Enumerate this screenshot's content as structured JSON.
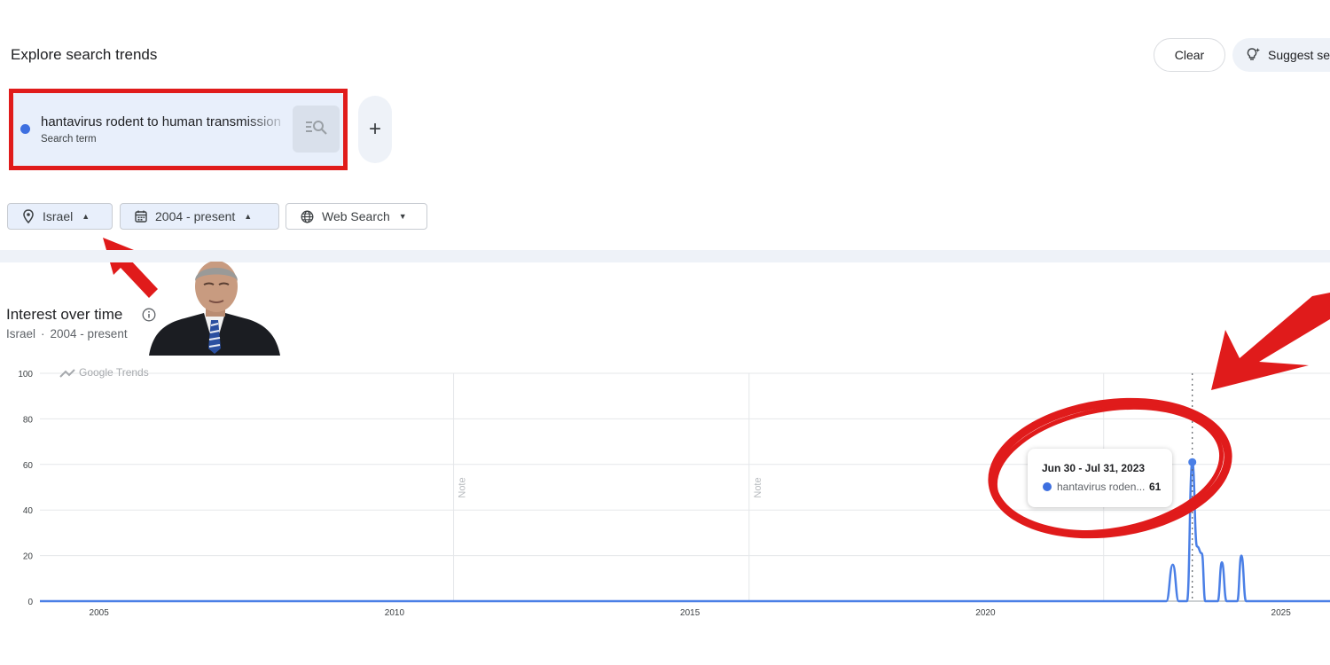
{
  "header": {
    "title": "Explore search trends",
    "clear_label": "Clear",
    "suggest_label": "Suggest sea"
  },
  "search_term": {
    "text": "hantavirus rodent to human transmission",
    "type_label": "Search term",
    "color": "#3d6fe0"
  },
  "add_term_label": "+",
  "filters": {
    "geo": "Israel",
    "time": "2004 - present",
    "property": "Web Search"
  },
  "section": {
    "title": "Interest over time",
    "sub_geo": "Israel",
    "sub_sep": "·",
    "sub_time": "2004 - present"
  },
  "chart_data": {
    "type": "line",
    "watermark": "Google Trends",
    "ylim": [
      0,
      100
    ],
    "yticks": [
      0,
      20,
      40,
      60,
      80,
      100
    ],
    "xlim": [
      2004,
      2025.83
    ],
    "xticks": [
      2005,
      2010,
      2015,
      2020,
      2025
    ],
    "grid": true,
    "series": [
      {
        "name": "hantavirus rodent to human transmission",
        "color": "#4a7fe6",
        "points": [
          [
            2004.0,
            0
          ],
          [
            2005.5,
            0
          ],
          [
            2010.5,
            0
          ],
          [
            2015.5,
            0
          ],
          [
            2020.5,
            0
          ],
          [
            2023.06,
            0
          ],
          [
            2023.17,
            16
          ],
          [
            2023.27,
            0
          ],
          [
            2023.41,
            0
          ],
          [
            2023.5,
            61
          ],
          [
            2023.58,
            24
          ],
          [
            2023.66,
            21
          ],
          [
            2023.72,
            0
          ],
          [
            2023.93,
            0
          ],
          [
            2024.0,
            17
          ],
          [
            2024.08,
            0
          ],
          [
            2024.26,
            0
          ],
          [
            2024.33,
            20
          ],
          [
            2024.41,
            0
          ],
          [
            2025.83,
            0
          ]
        ]
      }
    ],
    "notes": [
      {
        "label": "Note",
        "x": 2011.0
      },
      {
        "label": "Note",
        "x": 2016.0
      }
    ],
    "extra_vlines": [
      2022.0
    ],
    "tooltip": {
      "date": "Jun 30 - Jul 31, 2023",
      "series_label": "hantavirus roden...",
      "value": 61,
      "x": 2023.5
    }
  }
}
